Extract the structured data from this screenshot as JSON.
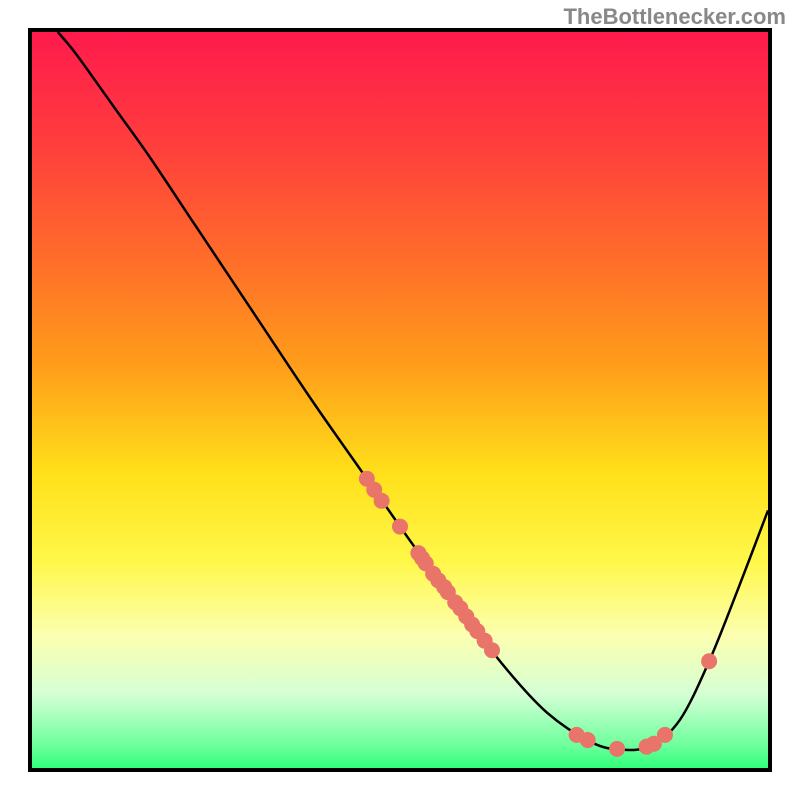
{
  "watermark": "TheBottlenecker.com",
  "chart_data": {
    "type": "line",
    "title": "",
    "xlabel": "",
    "ylabel": "",
    "xlim": [
      0,
      1
    ],
    "ylim": [
      0,
      1
    ],
    "background": {
      "type": "vertical-gradient",
      "stops": [
        {
          "offset": 0.0,
          "color": "#ff1a4d"
        },
        {
          "offset": 0.15,
          "color": "#ff3d3d"
        },
        {
          "offset": 0.3,
          "color": "#ff6a2b"
        },
        {
          "offset": 0.45,
          "color": "#ff9c1a"
        },
        {
          "offset": 0.6,
          "color": "#ffe01a"
        },
        {
          "offset": 0.72,
          "color": "#fff84a"
        },
        {
          "offset": 0.82,
          "color": "#fcffb0"
        },
        {
          "offset": 0.9,
          "color": "#d4ffd4"
        },
        {
          "offset": 0.97,
          "color": "#6cff9c"
        },
        {
          "offset": 1.0,
          "color": "#2fff7a"
        }
      ]
    },
    "series": [
      {
        "name": "curve",
        "color": "#000000",
        "points": [
          {
            "x": 0.035,
            "y": 1.0
          },
          {
            "x": 0.06,
            "y": 0.97
          },
          {
            "x": 0.11,
            "y": 0.9
          },
          {
            "x": 0.16,
            "y": 0.83
          },
          {
            "x": 0.22,
            "y": 0.74
          },
          {
            "x": 0.3,
            "y": 0.62
          },
          {
            "x": 0.38,
            "y": 0.5
          },
          {
            "x": 0.45,
            "y": 0.4
          },
          {
            "x": 0.52,
            "y": 0.3
          },
          {
            "x": 0.58,
            "y": 0.22
          },
          {
            "x": 0.64,
            "y": 0.14
          },
          {
            "x": 0.7,
            "y": 0.075
          },
          {
            "x": 0.76,
            "y": 0.035
          },
          {
            "x": 0.8,
            "y": 0.025
          },
          {
            "x": 0.84,
            "y": 0.03
          },
          {
            "x": 0.88,
            "y": 0.065
          },
          {
            "x": 0.92,
            "y": 0.145
          },
          {
            "x": 0.96,
            "y": 0.245
          },
          {
            "x": 1.0,
            "y": 0.35
          }
        ]
      }
    ],
    "scatter_points": {
      "color": "#e8746a",
      "radius": 8,
      "points": [
        {
          "x": 0.455,
          "y": 0.393
        },
        {
          "x": 0.465,
          "y": 0.378
        },
        {
          "x": 0.475,
          "y": 0.363
        },
        {
          "x": 0.5,
          "y": 0.328
        },
        {
          "x": 0.525,
          "y": 0.292
        },
        {
          "x": 0.53,
          "y": 0.285
        },
        {
          "x": 0.535,
          "y": 0.278
        },
        {
          "x": 0.545,
          "y": 0.264
        },
        {
          "x": 0.552,
          "y": 0.255
        },
        {
          "x": 0.56,
          "y": 0.246
        },
        {
          "x": 0.565,
          "y": 0.239
        },
        {
          "x": 0.575,
          "y": 0.225
        },
        {
          "x": 0.582,
          "y": 0.217
        },
        {
          "x": 0.59,
          "y": 0.206
        },
        {
          "x": 0.598,
          "y": 0.195
        },
        {
          "x": 0.605,
          "y": 0.186
        },
        {
          "x": 0.615,
          "y": 0.173
        },
        {
          "x": 0.625,
          "y": 0.16
        },
        {
          "x": 0.74,
          "y": 0.045
        },
        {
          "x": 0.755,
          "y": 0.038
        },
        {
          "x": 0.795,
          "y": 0.026
        },
        {
          "x": 0.835,
          "y": 0.029
        },
        {
          "x": 0.845,
          "y": 0.033
        },
        {
          "x": 0.86,
          "y": 0.045
        },
        {
          "x": 0.92,
          "y": 0.145
        }
      ]
    }
  }
}
